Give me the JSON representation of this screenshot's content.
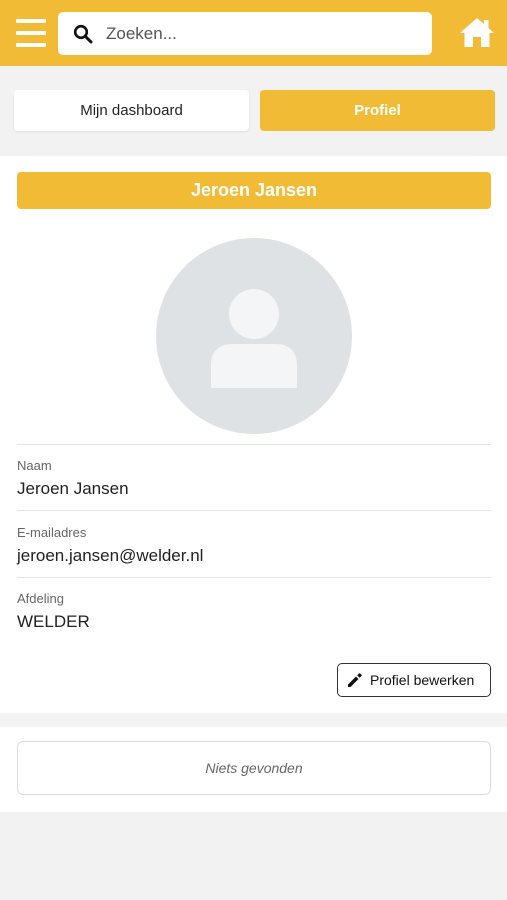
{
  "header": {
    "menu_icon": "hamburger-menu-icon",
    "search": {
      "placeholder": "Zoeken...",
      "value": "",
      "icon": "search-icon"
    },
    "home_icon": "home-icon",
    "accent_color": "#f2bb35"
  },
  "tabs": [
    {
      "label": "Mijn dashboard",
      "active": false
    },
    {
      "label": "Profiel",
      "active": true
    }
  ],
  "profile": {
    "name": "Jeroen Jansen",
    "avatar_icon": "user-placeholder-icon",
    "fields": [
      {
        "label": "Naam",
        "value": "Jeroen Jansen"
      },
      {
        "label": "E-mailadres",
        "value": "jeroen.jansen@welder.nl"
      },
      {
        "label": "Afdeling",
        "value": "WELDER"
      }
    ],
    "edit_button": {
      "label": "Profiel bewerken",
      "icon": "pencil-icon"
    }
  },
  "results": {
    "empty_text": "Niets gevonden"
  }
}
